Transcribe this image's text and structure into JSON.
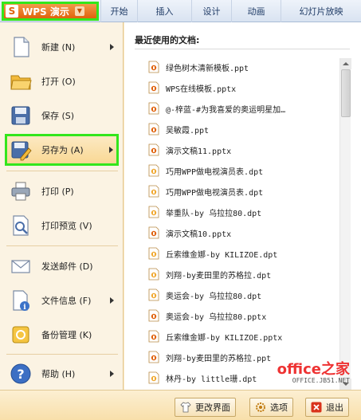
{
  "app": {
    "name": "WPS 演示",
    "logo": "S",
    "dropdown_glyph": "▼"
  },
  "tabs": [
    "开始",
    "插入",
    "设计",
    "动画",
    "幻灯片放映"
  ],
  "menu": [
    {
      "label": "新建 (N)",
      "icon": "new-document-icon",
      "arrow": true
    },
    {
      "label": "打开 (O)",
      "icon": "open-folder-icon",
      "arrow": false
    },
    {
      "label": "保存 (S)",
      "icon": "save-disk-icon",
      "arrow": false
    },
    {
      "label": "另存为 (A)",
      "icon": "save-as-icon",
      "arrow": true,
      "selected": true
    },
    {
      "label": "打印 (P)",
      "icon": "printer-icon",
      "arrow": false
    },
    {
      "label": "打印预览 (V)",
      "icon": "print-preview-icon",
      "arrow": false
    },
    {
      "label": "发送邮件 (D)",
      "icon": "mail-icon",
      "arrow": false
    },
    {
      "label": "文件信息 (F)",
      "icon": "file-info-icon",
      "arrow": true
    },
    {
      "label": "备份管理 (K)",
      "icon": "backup-icon",
      "arrow": false
    },
    {
      "label": "帮助 (H)",
      "icon": "help-icon",
      "arrow": true
    }
  ],
  "recent": {
    "heading": "最近使用的文档:",
    "documents": [
      "绿色树木清新模板.ppt",
      "WPS在线模板.pptx",
      "@-梓蓝-#为我喜爱的奥运明星加…",
      "吴敏霞.ppt",
      "演示文稿11.pptx",
      "巧用WPP做电视演员表.dpt",
      "巧用WPP做电视演员表.dpt",
      "举重队-by 乌拉拉80.dpt",
      "演示文稿10.pptx",
      "丘索维金娜-by KILIZOE.dpt",
      "刘翔-by麦田里的苏格拉.dpt",
      "奥运会-by 乌拉拉80.dpt",
      "奥运会-by 乌拉拉80.pptx",
      "丘索维金娜-by KILIZOE.pptx",
      "刘翔-by麦田里的苏格拉.ppt",
      "林丹-by little珊.dpt"
    ]
  },
  "watermark": {
    "main": "office之家",
    "sub": "OFFICE.JB51.NET"
  },
  "bottom": {
    "change_ui": "更改界面",
    "options": "选项",
    "exit": "退出"
  },
  "colors": {
    "accent_orange": "#e0620c",
    "highlight_green": "#33e61c",
    "panel_bg": "#fbf3e3"
  }
}
